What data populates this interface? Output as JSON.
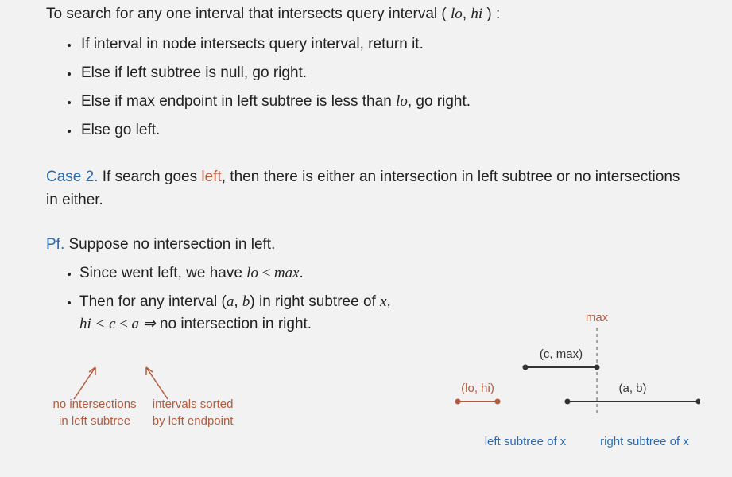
{
  "intro_prefix": "To search for any one interval that intersects query interval ",
  "query_open": " ( ",
  "lo": "lo",
  "comma_sp": ",  ",
  "hi": "hi",
  "query_close": " ) ",
  "colon": ":",
  "bullets1": {
    "b1": "If interval in node intersects query interval, return it.",
    "b2": "Else if left subtree is null, go right.",
    "b3_pre": "Else if max endpoint in left subtree is less than ",
    "b3_post": ", go right.",
    "b4": "Else go left."
  },
  "case2": {
    "label": "Case 2.",
    "pre": "  If search goes ",
    "left": "left",
    "post": ", then there is either an intersection in left subtree or no intersections in either."
  },
  "pf": {
    "label": "Pf.",
    "suppose": "  Suppose no intersection in left.",
    "b1_pre": "Since went left, we have ",
    "b1_math": "lo  ≤  max",
    "b1_post": ".",
    "b2_pre": "Then for any interval ",
    "b2_ab_open": "(",
    "b2_a": "a",
    "b2_comma": ", ",
    "b2_b": "b",
    "b2_ab_close": ")",
    "b2_mid": "  in right subtree of ",
    "b2_x": "x",
    "b2_post": ",",
    "line2_math": "hi  < c  ≤  a  ⇒",
    "line2_text": "  no intersection in right."
  },
  "annot": {
    "left1": "no intersections",
    "left2": "in left subtree",
    "right1": "intervals sorted",
    "right2": "by left endpoint"
  },
  "diagram": {
    "max": "max",
    "cmax": "(c, max)",
    "lohi": "(lo, hi)",
    "ab": "(a, b)",
    "leftsub": "left subtree of x",
    "rightsub": "right subtree of x"
  }
}
